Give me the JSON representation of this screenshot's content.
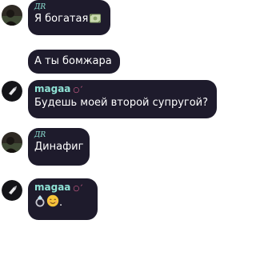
{
  "messages": [
    {
      "sender": "ДR",
      "text": "Я богатая",
      "emoji": "money-with-wings-icon"
    },
    {
      "sender": "",
      "text": "А ты бомжара"
    },
    {
      "sender": "magaa",
      "sender_mark": "○ˊ",
      "text": "Будешь моей второй супругой?"
    },
    {
      "sender": "ДR",
      "text": "Динафиг"
    },
    {
      "sender": "magaa",
      "sender_mark": "○ˊ",
      "text": "",
      "emoji": [
        "ring-icon",
        "smiling-face-icon"
      ],
      "suffix": "."
    }
  ],
  "colors": {
    "bubble": "#1e1b2c",
    "text": "#ffffff",
    "author": "#8fe3d6",
    "author_mark": "#f06a9b"
  }
}
